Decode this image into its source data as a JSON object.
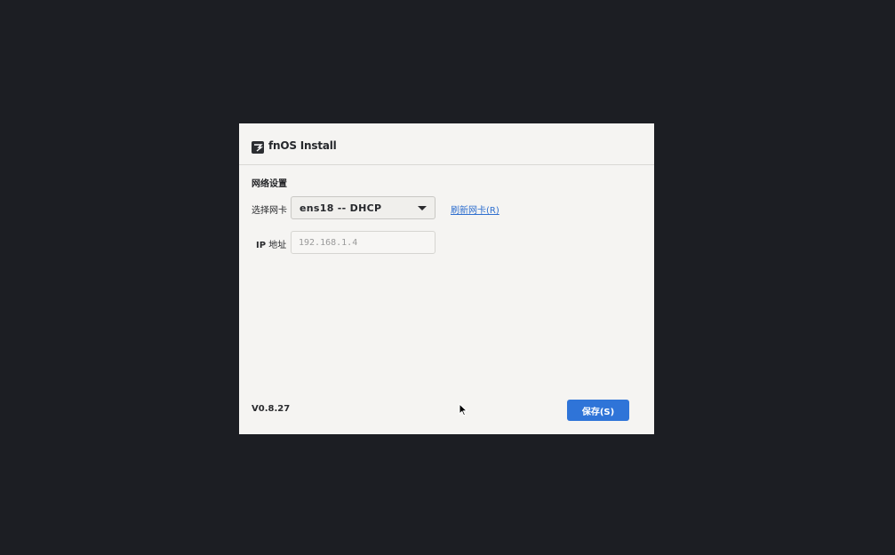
{
  "window": {
    "title": "fnOS Install",
    "logo_icon": "fnos-logo-icon"
  },
  "network": {
    "section_title": "网络设置",
    "nic_label": "选择网卡",
    "nic_selected": "ens18 -- DHCP",
    "refresh_link": "刷新网卡(R)",
    "ip_label_bold": "IP",
    "ip_label_rest": " 地址",
    "ip_placeholder": "192.168.1.4",
    "ip_value": ""
  },
  "footer": {
    "version": "V0.8.27",
    "save_label": "保存(S)"
  },
  "colors": {
    "desktop_bg": "#1c1e23",
    "window_bg": "#f5f4f2",
    "accent": "#2f74d8",
    "link": "#2f6fcf"
  }
}
